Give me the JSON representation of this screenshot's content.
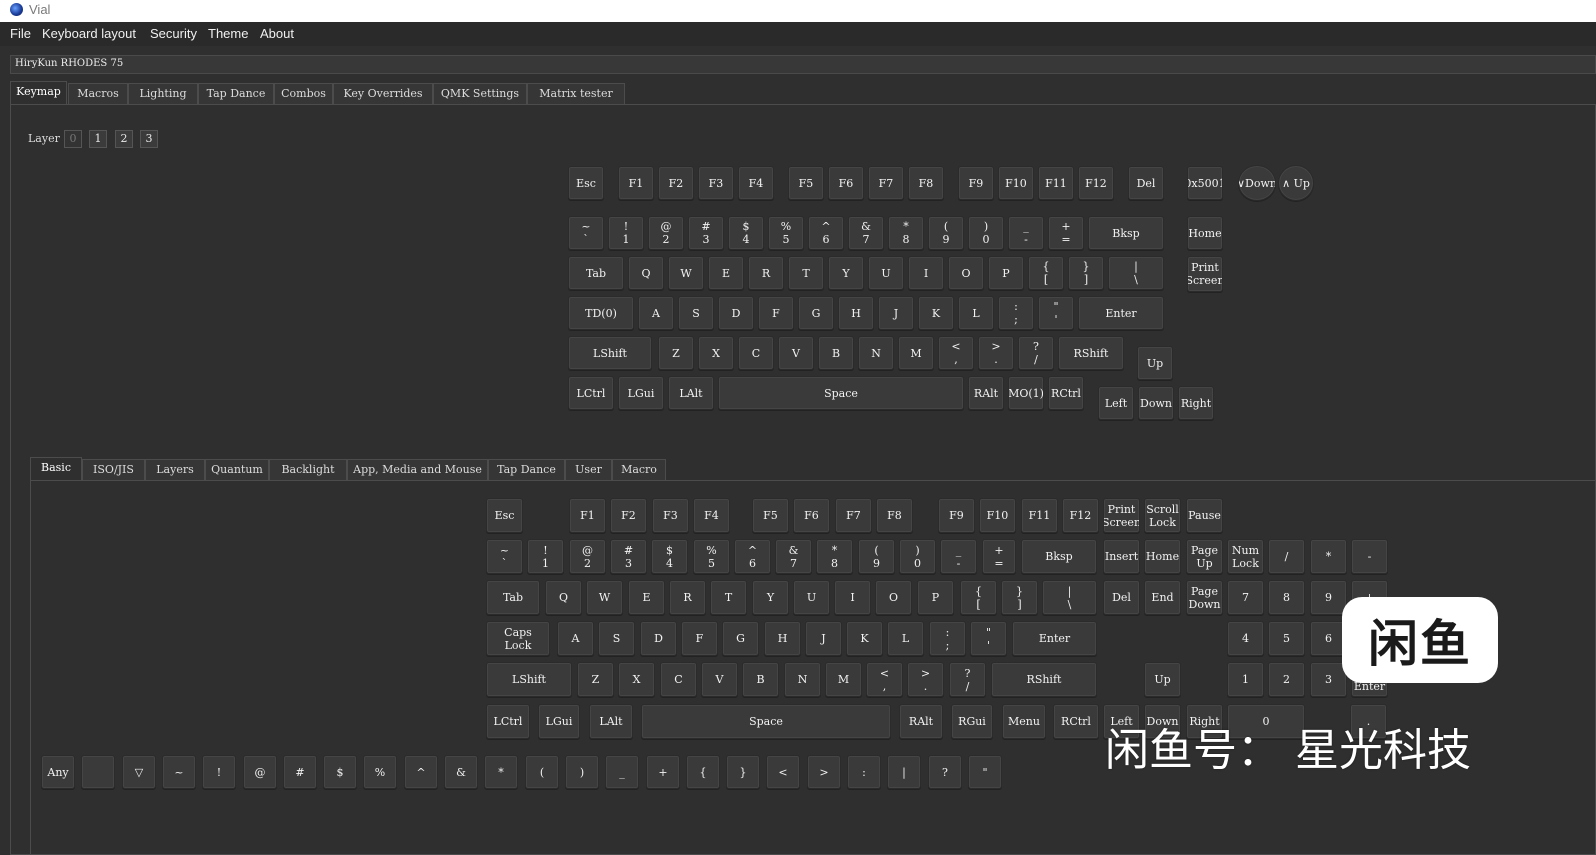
{
  "window": {
    "title": "Vial"
  },
  "menu": [
    "File",
    "Keyboard layout",
    "Security",
    "Theme",
    "About"
  ],
  "device": {
    "name": "HiryKun RHODES 75"
  },
  "main_tabs": [
    "Keymap",
    "Macros",
    "Lighting",
    "Tap Dance",
    "Combos",
    "Key Overrides",
    "QMK Settings",
    "Matrix tester"
  ],
  "layer": {
    "label": "Layer",
    "buttons": [
      "0",
      "1",
      "2",
      "3"
    ]
  },
  "keymap_keys": [
    "Esc",
    "F1",
    "F2",
    "F3",
    "F4",
    "F5",
    "F6",
    "F7",
    "F8",
    "F9",
    "F10",
    "F11",
    "F12",
    "Del",
    "0x5001",
    "∨Down",
    "∧ Up",
    "~\n`",
    "!\n1",
    "@\n2",
    "#\n3",
    "$\n4",
    "%\n5",
    "^\n6",
    "&\n7",
    "*\n8",
    "(\n9",
    ")\n0",
    "_\n-",
    "+\n=",
    "Bksp",
    "Home",
    "Tab",
    "Q",
    "W",
    "E",
    "R",
    "T",
    "Y",
    "U",
    "I",
    "O",
    "P",
    "{\n[",
    "}\n]",
    "|\n\\",
    "Print\nScreen",
    "TD(0)",
    "A",
    "S",
    "D",
    "F",
    "G",
    "H",
    "J",
    "K",
    "L",
    ":\n;",
    "\"\n'",
    "Enter",
    "LShift",
    "Z",
    "X",
    "C",
    "V",
    "B",
    "N",
    "M",
    "<\n,",
    ">\n.",
    "?\n/",
    "RShift",
    "Up",
    "LCtrl",
    "LGui",
    "LAlt",
    "Space",
    "RAlt",
    "MO(1)",
    "RCtrl",
    "Left",
    "Down",
    "Right"
  ],
  "category_tabs": [
    "Basic",
    "ISO/JIS",
    "Layers",
    "Quantum",
    "Backlight",
    "App, Media and Mouse",
    "Tap Dance",
    "User",
    "Macro"
  ],
  "basic_keys": [
    "Esc",
    "F1",
    "F2",
    "F3",
    "F4",
    "F5",
    "F6",
    "F7",
    "F8",
    "F9",
    "F10",
    "F11",
    "F12",
    "Print\nScreen",
    "Scroll\nLock",
    "Pause",
    "~\n`",
    "!\n1",
    "@\n2",
    "#\n3",
    "$\n4",
    "%\n5",
    "^\n6",
    "&\n7",
    "*\n8",
    "(\n9",
    ")\n0",
    "_\n-",
    "+\n=",
    "Bksp",
    "Insert",
    "Home",
    "Page\nUp",
    "Num\nLock",
    "/",
    "*",
    "-",
    "Tab",
    "Q",
    "W",
    "E",
    "R",
    "T",
    "Y",
    "U",
    "I",
    "O",
    "P",
    "{\n[",
    "}\n]",
    "|\n\\",
    "Del",
    "End",
    "Page\nDown",
    "7",
    "8",
    "9",
    "+",
    "Caps\nLock",
    "A",
    "S",
    "D",
    "F",
    "G",
    "H",
    "J",
    "K",
    "L",
    ":\n;",
    "\"\n'",
    "Enter",
    "4",
    "5",
    "6",
    "LShift",
    "Z",
    "X",
    "C",
    "V",
    "B",
    "N",
    "M",
    "<\n,",
    ">\n.",
    "?\n/",
    "RShift",
    "Up",
    "1",
    "2",
    "3",
    "Num\nEnter",
    "LCtrl",
    "LGui",
    "LAlt",
    "Space",
    "RAlt",
    "RGui",
    "Menu",
    "RCtrl",
    "Left",
    "Down",
    "Right",
    "0",
    "."
  ],
  "symbol_keys": [
    "Any",
    "",
    "▽",
    "~",
    "!",
    "@",
    "#",
    "$",
    "%",
    "^",
    "&",
    "*",
    "(",
    ")",
    "_",
    "+",
    "{",
    "}",
    "<",
    ">",
    ":",
    "|",
    "?",
    "\""
  ],
  "watermark": {
    "logo": "闲鱼",
    "text": "闲鱼号： 星光科技"
  },
  "colors": {
    "background": "#2f2f2f",
    "key": "#3a3a3a",
    "key_text": "#f2f2f2",
    "titlebar": "#ffffff"
  }
}
